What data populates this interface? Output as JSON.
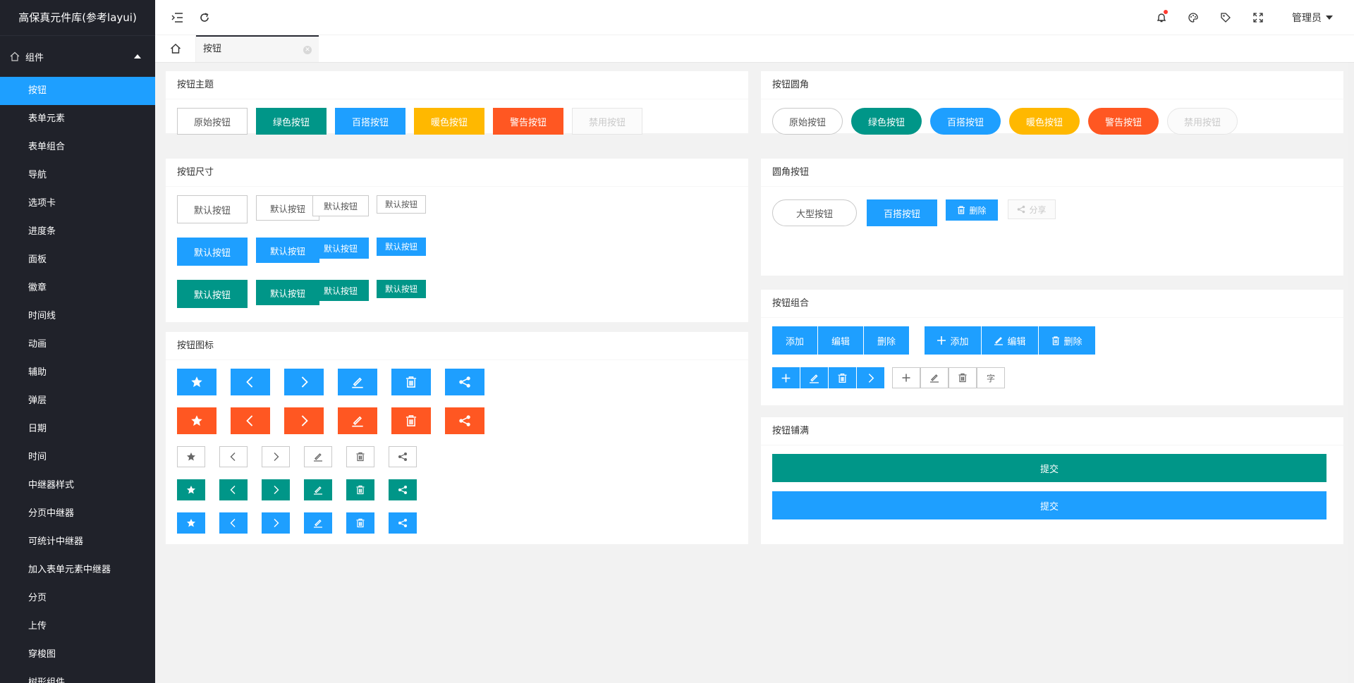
{
  "app": {
    "title": "高保真元件库(参考layui)"
  },
  "sidebar": {
    "group": "组件",
    "items": [
      "按钮",
      "表单元素",
      "表单组合",
      "导航",
      "选项卡",
      "进度条",
      "面板",
      "徽章",
      "时间线",
      "动画",
      "辅助",
      "弹层",
      "日期",
      "时间",
      "中继器样式",
      "分页中继器",
      "可统计中继器",
      "加入表单元素中继器",
      "分页",
      "上传",
      "穿梭图",
      "树形组件"
    ],
    "active_index": 0
  },
  "header": {
    "user": "管理员"
  },
  "tabs": [
    {
      "label": "按钮"
    }
  ],
  "theme": {
    "title": "按钮主题",
    "buttons": [
      "原始按钮",
      "绿色按钮",
      "百搭按钮",
      "暖色按钮",
      "警告按钮",
      "禁用按钮"
    ]
  },
  "size": {
    "title": "按钮尺寸",
    "label": "默认按钮"
  },
  "icons": {
    "title": "按钮图标"
  },
  "radius": {
    "title": "按钮圆角",
    "buttons": [
      "原始按钮",
      "绿色按钮",
      "百搭按钮",
      "暖色按钮",
      "警告按钮",
      "禁用按钮"
    ]
  },
  "mixed": {
    "title": "圆角按钮",
    "big": "大型按钮",
    "normal": "百搭按钮",
    "delete": "删除",
    "share": "分享"
  },
  "group": {
    "title": "按钮组合",
    "add": "添加",
    "edit": "编辑",
    "delete": "删除",
    "char": "字"
  },
  "fluid": {
    "title": "按钮铺满",
    "submit": "提交"
  },
  "colors": {
    "primary": "#1e9fff",
    "green": "#009688",
    "warm": "#ffb800",
    "danger": "#ff5722",
    "sidebar": "#20222a"
  }
}
